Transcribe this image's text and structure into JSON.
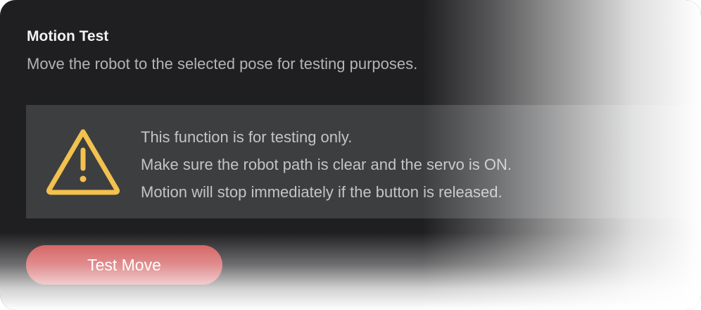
{
  "section": {
    "title": "Motion Test",
    "description": "Move the robot to the selected pose for testing purposes."
  },
  "warning": {
    "icon": "warning-triangle-icon",
    "icon_color": "#f2c14e",
    "lines": [
      "This function is for testing only.",
      "Make sure the robot path is clear and the servo is ON.",
      "Motion will stop immediately if the button is released."
    ]
  },
  "actions": {
    "test_move_label": "Test Move",
    "test_move_color": "#d04e50"
  }
}
